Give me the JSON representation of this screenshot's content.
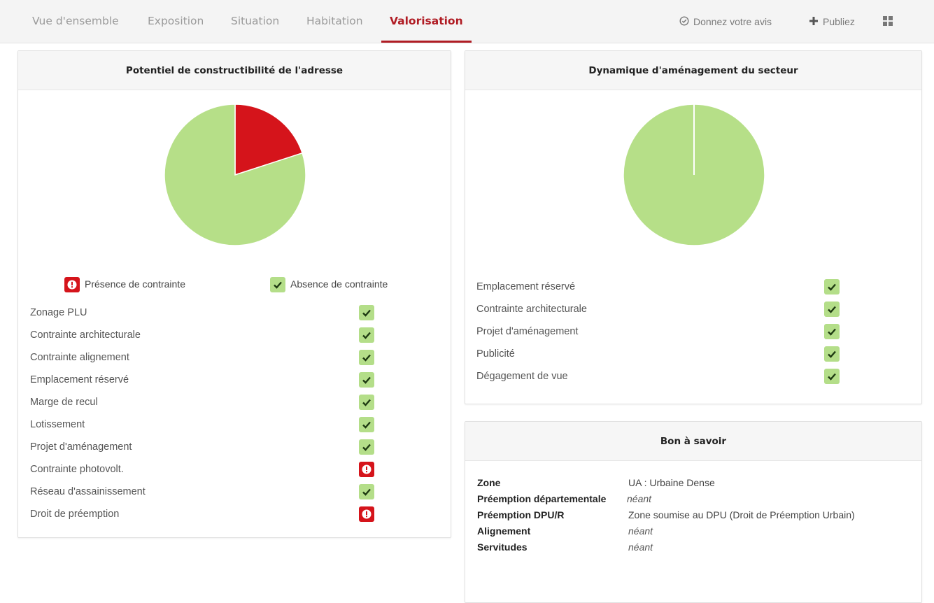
{
  "nav": {
    "tabs": [
      {
        "label": "Vue d'ensemble"
      },
      {
        "label": "Exposition"
      },
      {
        "label": "Situation"
      },
      {
        "label": "Habitation"
      },
      {
        "label": "Valorisation",
        "active": true
      }
    ],
    "actions": {
      "feedback_label": "Donnez votre avis",
      "feedback_icon": "check-circle-icon",
      "publish_label": "Publiez",
      "publish_icon": "plus-icon",
      "grid_icon": "grid-icon"
    }
  },
  "colors": {
    "accent": "#b01c24",
    "ok": "#b4de89",
    "ko": "#d5141b",
    "pie_ok": "#b6df88",
    "pie_ko": "#d5141b"
  },
  "constructibility": {
    "title": "Potentiel de constructibilité de l'adresse",
    "chart_data": {
      "type": "pie",
      "labels": [
        "Présence de contrainte",
        "Absence de contrainte"
      ],
      "values": [
        2,
        8
      ]
    },
    "legend": {
      "presence": "Présence de contrainte",
      "absence": "Absence de contrainte"
    },
    "rows": [
      {
        "label": "Zonage PLU",
        "status": "ok"
      },
      {
        "label": "Contrainte architecturale",
        "status": "ok"
      },
      {
        "label": "Contrainte alignement",
        "status": "ok"
      },
      {
        "label": "Emplacement réservé",
        "status": "ok"
      },
      {
        "label": "Marge de recul",
        "status": "ok"
      },
      {
        "label": "Lotissement",
        "status": "ok"
      },
      {
        "label": "Projet d'aménagement",
        "status": "ok"
      },
      {
        "label": "Contrainte photovolt.",
        "status": "ko"
      },
      {
        "label": "Réseau d'assainissement",
        "status": "ok"
      },
      {
        "label": "Droit de préemption",
        "status": "ko"
      }
    ]
  },
  "dynamics": {
    "title": "Dynamique d'aménagement du secteur",
    "chart_data": {
      "type": "pie",
      "labels": [
        "Présence de contrainte",
        "Absence de contrainte"
      ],
      "values": [
        0,
        5
      ]
    },
    "rows": [
      {
        "label": "Emplacement réservé",
        "status": "ok"
      },
      {
        "label": "Contrainte architecturale",
        "status": "ok"
      },
      {
        "label": "Projet d'aménagement",
        "status": "ok"
      },
      {
        "label": "Publicité",
        "status": "ok"
      },
      {
        "label": "Dégagement de vue",
        "status": "ok"
      }
    ]
  },
  "good_to_know": {
    "title": "Bon à savoir",
    "rows": [
      {
        "key": "Zone",
        "value": "UA : Urbaine Dense",
        "italic": false
      },
      {
        "key": "Préemption départementale",
        "value": "néant",
        "italic": true
      },
      {
        "key": "Préemption DPU/R",
        "value": "Zone soumise au DPU (Droit de Préemption Urbain)",
        "italic": false
      },
      {
        "key": "Alignement",
        "value": "néant",
        "italic": true
      },
      {
        "key": "Servitudes",
        "value": "néant",
        "italic": true
      }
    ]
  }
}
